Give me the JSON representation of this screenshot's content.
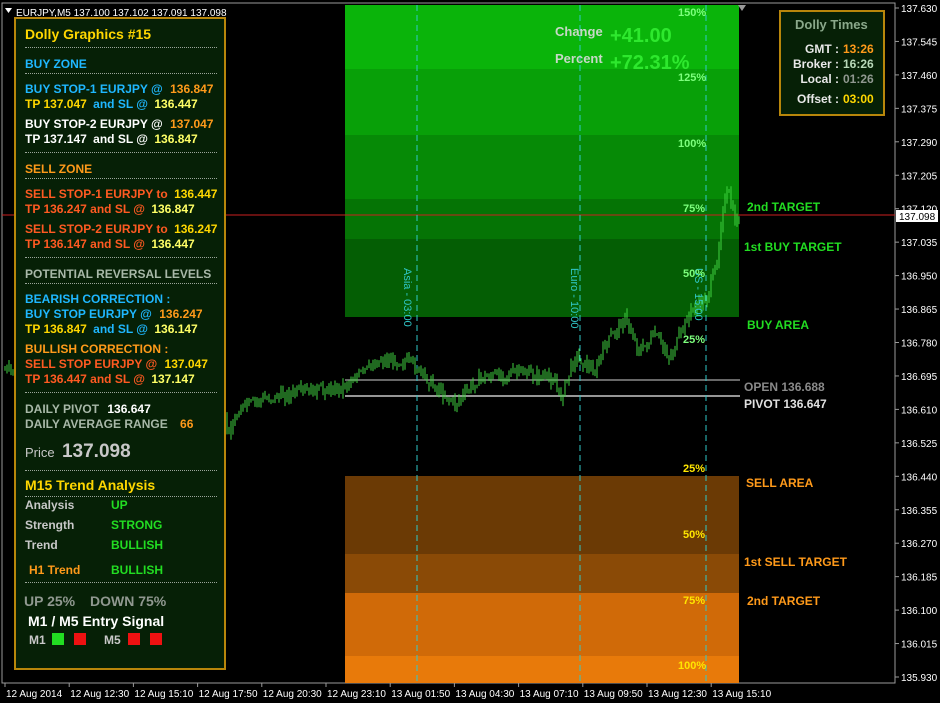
{
  "window": {
    "title": "EURJPY,M5  137.100 137.102 137.091 137.098"
  },
  "price_axis": {
    "labels": [
      "137.630",
      "137.545",
      "137.460",
      "137.375",
      "137.290",
      "137.205",
      "137.120",
      "137.035",
      "136.950",
      "136.865",
      "136.780",
      "136.695",
      "136.610",
      "136.525",
      "136.440",
      "136.355",
      "136.270",
      "136.185",
      "136.100",
      "136.015",
      "135.930"
    ],
    "current_price": "137.098"
  },
  "time_axis": {
    "labels": [
      "12 Aug 2014",
      "12 Aug 12:30",
      "12 Aug 15:10",
      "12 Aug 17:50",
      "12 Aug 20:30",
      "12 Aug 23:10",
      "13 Aug 01:50",
      "13 Aug 04:30",
      "13 Aug 07:10",
      "13 Aug 09:50",
      "13 Aug 12:30",
      "13 Aug 15:10"
    ]
  },
  "sessions": {
    "asia": "Asia - 03:00",
    "euro": "Euro - 10:00",
    "us": "US - 15:00"
  },
  "change": {
    "label": "Change",
    "value": "+41.00",
    "percent_label": "Percent",
    "percent_value": "+72.31%"
  },
  "buy_zone": {
    "levels": [
      "150%",
      "125%",
      "100%",
      "75%",
      "50%",
      "25%"
    ]
  },
  "sell_zone": {
    "levels": [
      "25%",
      "50%",
      "75%",
      "100%"
    ]
  },
  "right_labels": {
    "buy_2nd_target": "2nd TARGET",
    "buy_1st_target": "1st BUY TARGET",
    "buy_area": "BUY AREA",
    "open": "OPEN 136.688",
    "pivot": "PIVOT 136.647",
    "sell_area": "SELL AREA",
    "sell_1st_target": "1st SELL TARGET",
    "sell_2nd_target": "2nd TARGET"
  },
  "times": {
    "title": "Dolly Times",
    "gmt_label": "GMT :",
    "gmt": "13:26",
    "broker_label": "Broker :",
    "broker": "16:26",
    "local_label": "Local :",
    "local": "01:26",
    "offset_label": "Offset :",
    "offset": "03:00"
  },
  "panel": {
    "title": "Dolly Graphics #15",
    "buy_zone": "BUY ZONE",
    "bs1_a": "BUY STOP-1  EURJPY  @",
    "bs1_price": "136.847",
    "bs1_tp": "TP 137.047",
    "bs1_mid": "and SL @",
    "bs1_sl": "136.447",
    "bs2_a": "BUY STOP-2  EURJPY  @",
    "bs2_price": "137.047",
    "bs2_tp": "TP 137.147",
    "bs2_mid": "and SL @",
    "bs2_sl": "136.847",
    "sell_zone": "SELL ZONE",
    "ss1_a": "SELL STOP-1  EURJPY to",
    "ss1_price": "136.447",
    "ss1_tp": "TP 136.247  and SL @",
    "ss1_sl": "136.847",
    "ss2_a": "SELL STOP-2  EURJPY to",
    "ss2_price": "136.247",
    "ss2_tp": "TP 136.147  and SL @",
    "ss2_sl": "136.447",
    "reversal": "POTENTIAL REVERSAL LEVELS",
    "bearish": "BEARISH CORRECTION :",
    "bear_a": "BUY STOP EURJPY  @",
    "bear_price": "136.247",
    "bear_tp": "TP 136.847",
    "bear_mid": "and SL @",
    "bear_sl": "136.147",
    "bullish": "BULLISH CORRECTION :",
    "bull_a": "SELL STOP EURJPY  @",
    "bull_price": "137.047",
    "bull_tp": "TP 136.447  and SL @",
    "bull_sl": "137.147",
    "pivot_label": "DAILY PIVOT",
    "pivot_value": "136.647",
    "adr_label": "DAILY AVERAGE RANGE",
    "adr_value": "66",
    "price_label": "Price",
    "price_value": "137.098",
    "trend_title": "M15 Trend Analysis",
    "analysis_label": "Analysis",
    "analysis_value": "UP",
    "strength_label": "Strength",
    "strength_value": "STRONG",
    "trend_label": "Trend",
    "trend_value": "BULLISH",
    "h1_label": "H1 Trend",
    "h1_value": "BULLISH",
    "up_pct": "UP 25%",
    "down_pct": "DOWN 75%",
    "entry_title": "M1 /  M5 Entry Signal",
    "m1_label": "M1",
    "m5_label": "M5"
  },
  "colors": {
    "panel_bg": "#062006",
    "border": "#b8860b",
    "buy_label": "#1fb7ff",
    "sell_label": "#ff6a22",
    "gold": "#ffd700",
    "green": "#22dd22",
    "candle": "#3fd23f"
  }
}
